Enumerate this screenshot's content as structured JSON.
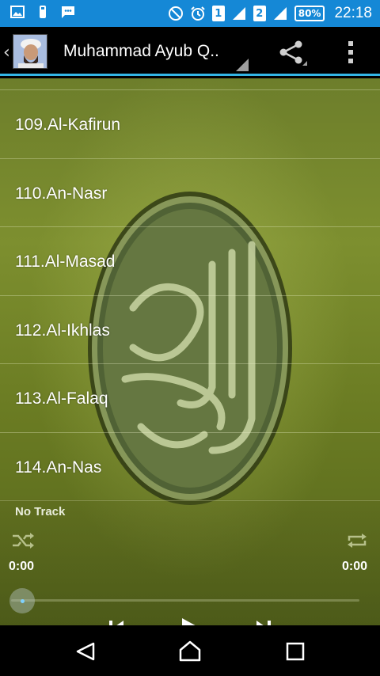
{
  "status_bar": {
    "sim1": "1",
    "sim2": "2",
    "battery": "80%",
    "time": "22:18"
  },
  "action_bar": {
    "title": "Muhammad Ayub Q..",
    "share_icon": "share-icon",
    "overflow_icon": "overflow-menu-icon"
  },
  "tracks": [
    {
      "label": ""
    },
    {
      "label": "109.Al-Kafirun"
    },
    {
      "label": "110.An-Nasr"
    },
    {
      "label": "111.Al-Masad"
    },
    {
      "label": "112.Al-Ikhlas"
    },
    {
      "label": "113.Al-Falaq"
    },
    {
      "label": "114.An-Nas"
    }
  ],
  "player": {
    "track_name": "No Track",
    "elapsed": "0:00",
    "duration": "0:00",
    "progress": 0
  },
  "colors": {
    "status_bar": "#1588d6",
    "accent": "#33b5e5",
    "background": "#6d7e2b"
  }
}
